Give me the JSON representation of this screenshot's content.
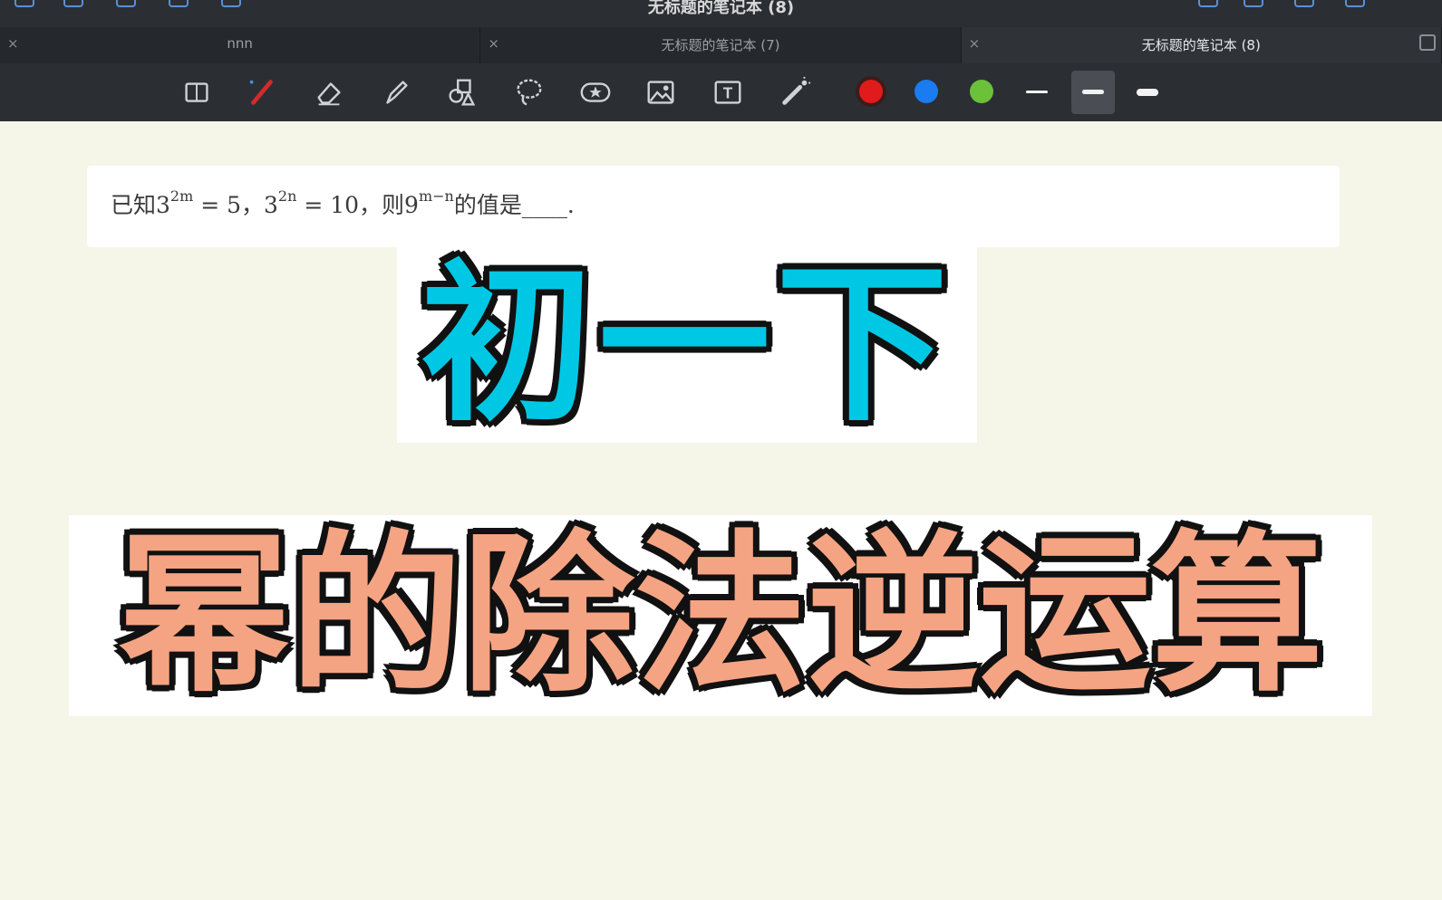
{
  "window": {
    "title": "无标题的笔记本 (8)"
  },
  "tabs": [
    {
      "label": "nnn",
      "close": "×",
      "active": false
    },
    {
      "label": "无标题的笔记本 (7)",
      "close": "×",
      "active": false
    },
    {
      "label": "无标题的笔记本 (8)",
      "close": "×",
      "active": true
    }
  ],
  "toolbar": {
    "tools": [
      "book-icon",
      "pen-icon",
      "eraser-icon",
      "highlighter-icon",
      "shapes-icon",
      "lasso-icon",
      "sticker-icon",
      "image-icon",
      "text-icon",
      "laser-pointer-icon"
    ],
    "colors": [
      {
        "name": "red",
        "hex": "#e01b1b",
        "selected": true
      },
      {
        "name": "blue",
        "hex": "#1a7cf0",
        "selected": false
      },
      {
        "name": "green",
        "hex": "#6cc13b",
        "selected": false
      }
    ],
    "stroke_sizes": [
      "thin",
      "medium",
      "thick"
    ],
    "selected_stroke": "medium"
  },
  "question": {
    "prefix": "已知3",
    "exp1": "2m",
    "eq1": " = 5，3",
    "exp2": "2n",
    "eq2": " = 10，则9",
    "exp3": "m−n",
    "suffix": "的值是____."
  },
  "overlay": {
    "title_line1": "初一下",
    "title_line2": "幂的除法逆运算",
    "colors": {
      "line1": "#00c8e4",
      "line2": "#f5a483",
      "outline": "#111111"
    }
  }
}
